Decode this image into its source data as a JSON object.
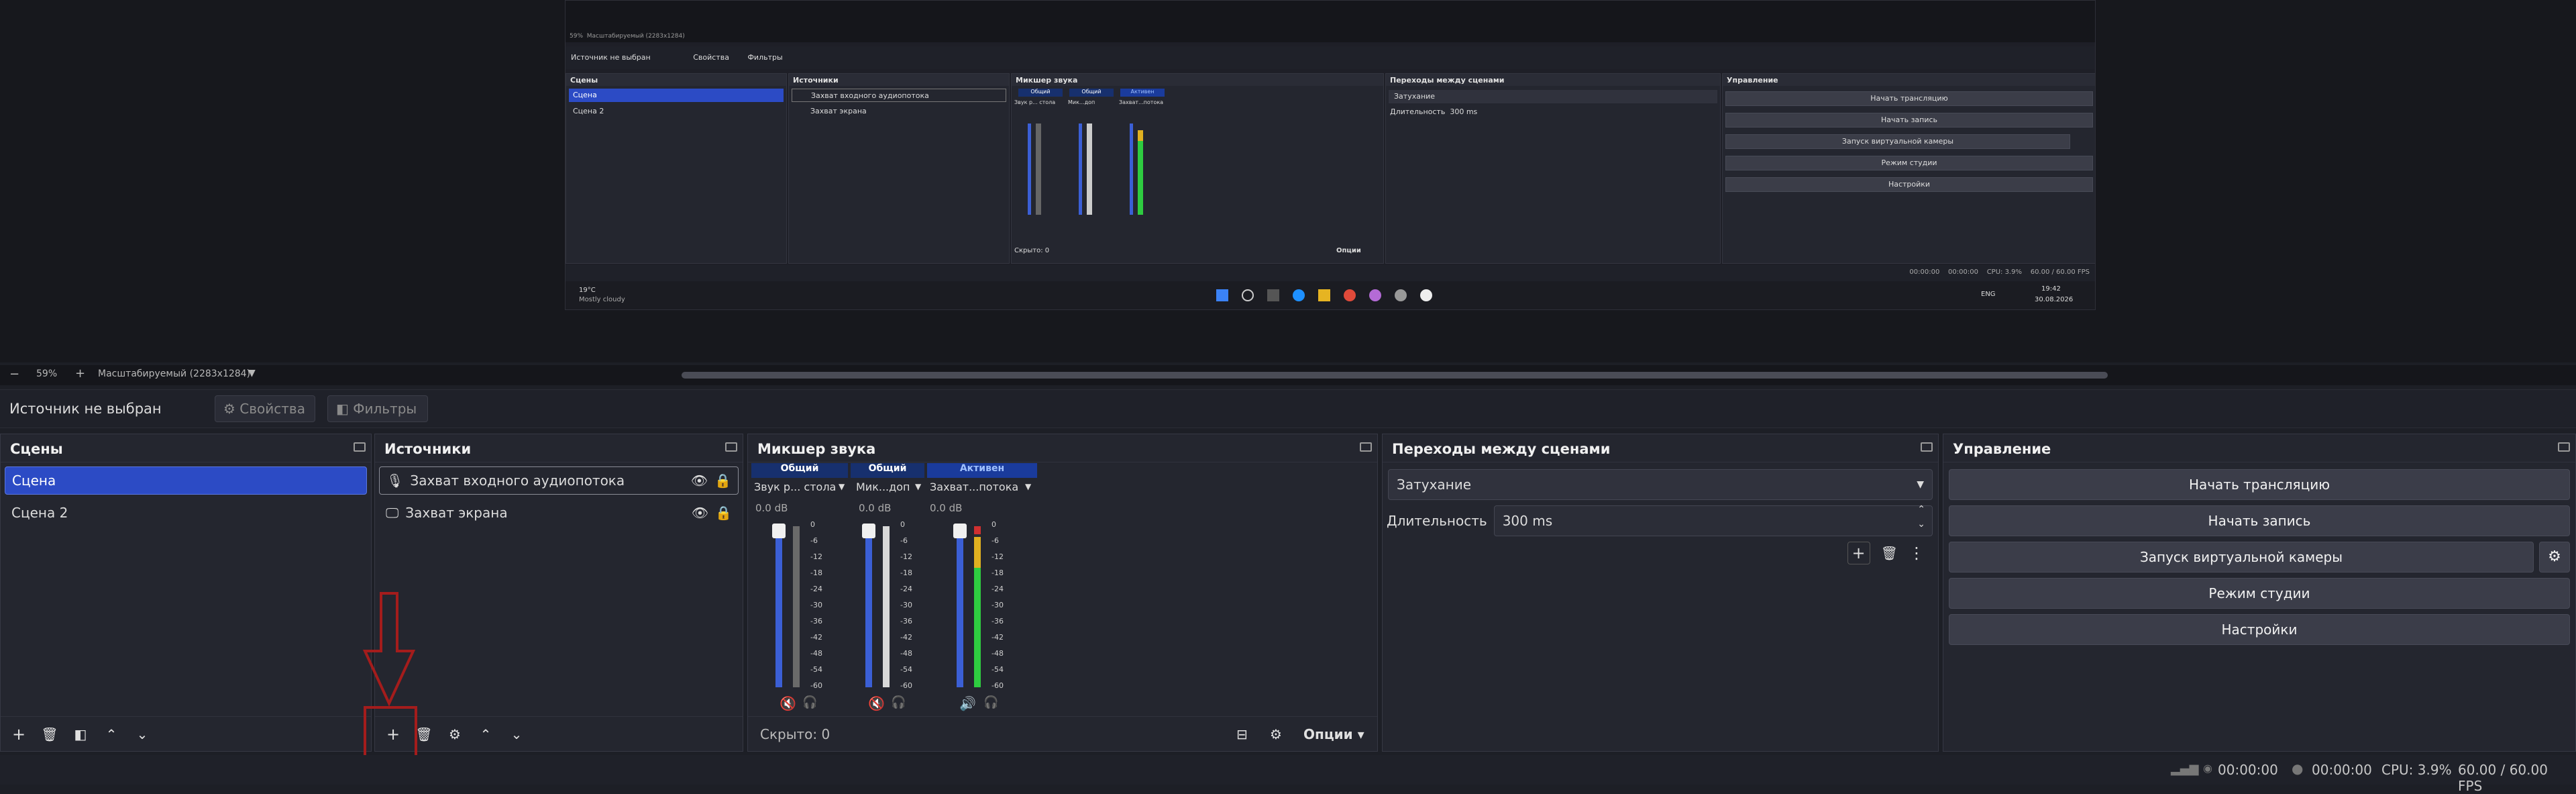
{
  "nested": {
    "zoom_small": "59%",
    "scale_small": "Масштабируемый (2283x1284)",
    "no_source": "Источник не выбран",
    "properties": "Свойства",
    "filters": "Фильтры",
    "scenes_title": "Сцены",
    "sources_title": "Источники",
    "mixer_title": "Микшер звука",
    "transitions_title": "Переходы между сценами",
    "controls_title": "Управление",
    "scene1": "Сцена",
    "scene2": "Сцена 2",
    "source1": "Захват входного аудиопотока",
    "source2": "Захват экрана",
    "ch1_head": "Общий",
    "ch2_head": "Общий",
    "ch3_head": "Активен",
    "ch1_name": "Звук р... стола",
    "ch2_name": "Мик...доп",
    "ch3_name": "Захват...потока",
    "transition": "Затухание",
    "duration_label": "Длительность",
    "duration_value": "300 ms",
    "hidden": "Скрыто: 0",
    "options": "Опции",
    "start_stream": "Начать трансляцию",
    "start_record": "Начать запись",
    "virtual_cam": "Запуск виртуальной камеры",
    "studio_mode": "Режим студии",
    "settings": "Настройки",
    "time1": "00:00:00",
    "time2": "00:00:00",
    "cpu": "CPU: 3.9%",
    "fps": "60.00 / 60.00 FPS",
    "weather_temp": "19°C",
    "weather_desc": "Mostly cloudy",
    "lang": "ENG",
    "clock_time": "19:42",
    "clock_date": "30.08.2026"
  },
  "zoom": {
    "minus": "−",
    "percent": "59%",
    "plus": "+",
    "scale": "Масштабируемый (2283x1284)"
  },
  "source_bar": {
    "no_source": "Источник не выбран",
    "properties": "Свойства",
    "filters": "Фильтры"
  },
  "scenes": {
    "title": "Сцены",
    "items": [
      "Сцена",
      "Сцена 2"
    ]
  },
  "sources": {
    "title": "Источники",
    "items": [
      "Захват входного аудиопотока",
      "Захват экрана"
    ]
  },
  "mixer": {
    "title": "Микшер звука",
    "channels": [
      {
        "header": "Общий",
        "name": "Звук р... стола",
        "db": "0.0 dB",
        "level": 0,
        "muted": true
      },
      {
        "header": "Общий",
        "name": "Мик...доп",
        "db": "0.0 dB",
        "level": 0,
        "muted": true
      },
      {
        "header": "Активен",
        "name": "Захват...потока",
        "db": "0.0 dB",
        "level": 0.72,
        "muted": false
      }
    ],
    "scale": [
      "0",
      "-6",
      "-12",
      "-18",
      "-24",
      "-30",
      "-36",
      "-42",
      "-48",
      "-54",
      "-60"
    ],
    "hidden": "Скрыто: 0",
    "options": "Опции"
  },
  "transitions": {
    "title": "Переходы между сценами",
    "selected": "Затухание",
    "duration_label": "Длительность",
    "duration_value": "300 ms"
  },
  "controls": {
    "title": "Управление",
    "start_stream": "Начать трансляцию",
    "start_record": "Начать запись",
    "virtual_cam": "Запуск виртуальной камеры",
    "studio_mode": "Режим студии",
    "settings": "Настройки"
  },
  "status": {
    "time1": "00:00:00",
    "time2": "00:00:00",
    "cpu": "CPU: 3.9%",
    "fps": "60.00 / 60.00 FPS"
  },
  "colors": {
    "accent": "#2c4bc5",
    "highlight": "#a41c1c",
    "meter_blue": "#3b5fd6",
    "meter_green": "#2ecc40",
    "meter_yellow": "#e0b020",
    "meter_red": "#d03030"
  }
}
